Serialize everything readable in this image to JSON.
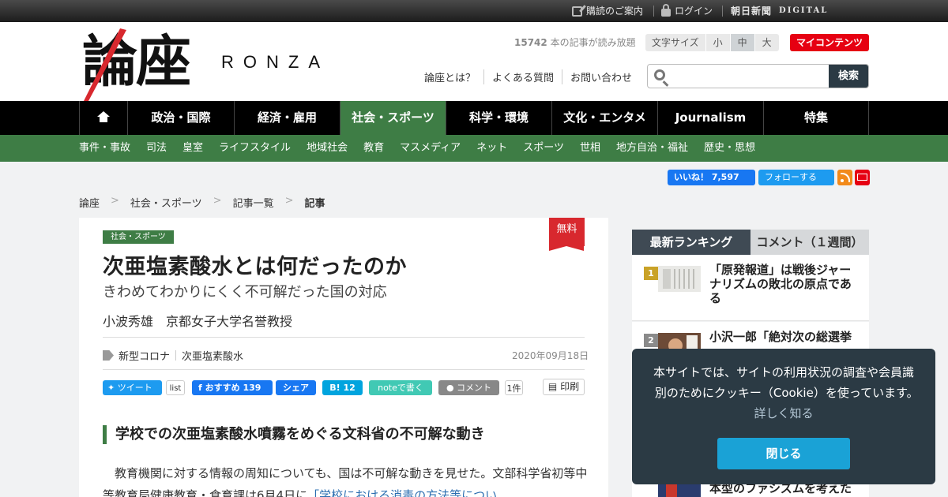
{
  "topbar": {
    "subscribe": "購読のご案内",
    "login": "ログイン",
    "asahi_logo": "朝日新聞",
    "asahi_digital": "DIGITAL"
  },
  "header": {
    "logo_kanji": "論座",
    "logo_roman": "RONZA",
    "reading_count": "15742",
    "reading_text": "本の記事が読み放題",
    "fontsize_label": "文字サイズ",
    "fontsize_options": [
      "小",
      "中",
      "大"
    ],
    "fontsize_selected": "中",
    "my_contents": "マイコンテンツ",
    "links": [
      "論座とは？",
      "よくある質問",
      "お問い合わせ"
    ],
    "search_placeholder": "",
    "search_button": "検索"
  },
  "nav": {
    "home_icon": "home-icon",
    "tabs": [
      "政治・国際",
      "経済・雇用",
      "社会・スポーツ",
      "科学・環境",
      "文化・エンタメ",
      "Journalism",
      "特集"
    ],
    "active": "社会・スポーツ",
    "subitems": [
      "事件・事故",
      "司法",
      "皇室",
      "ライフスタイル",
      "地域社会",
      "教育",
      "マスメディア",
      "ネット",
      "スポーツ",
      "世相",
      "地方自治・福祉",
      "歴史・思想"
    ]
  },
  "social": {
    "fb_like": "いいね！ 7,597",
    "tw_follow": "フォローする"
  },
  "breadcrumb": [
    "論座",
    "社会・スポーツ",
    "記事一覧",
    "記事"
  ],
  "article": {
    "category": "社会・スポーツ",
    "free_badge": "無料",
    "title": "次亜塩素酸水とは何だったのか",
    "subtitle": "きわめてわかりにくく不可解だった国の対応",
    "author": "小波秀雄　京都女子大学名誉教授",
    "tags": [
      "新型コロナ",
      "次亜塩素酸水"
    ],
    "date": "2020年09月18日",
    "share": {
      "tweet": "ツイート",
      "list": "list",
      "fb_recommend": "おすすめ 139",
      "fb_share": "シェア",
      "hatena": "B! 12",
      "note": "noteで書く",
      "comment": "コメント",
      "comment_count": "1件",
      "print": "印刷"
    },
    "heading": "学校での次亜塩素酸水噴霧をめぐる文科省の不可解な動き",
    "body_start": "教育機関に対する情報の周知についても、国は不可解な動きを見せた。文部科学省初等中等教育局健康教育・食育課は6月4日に",
    "body_link": "「学校における消毒の方法等につい"
  },
  "sidebar": {
    "tab_ranking": "最新ランキング",
    "tab_comment": "コメント（１週間）",
    "items": [
      {
        "rank": "1",
        "title": "「原発報道」は戦後ジャーナリズムの敗北の原点である"
      },
      {
        "rank": "2",
        "title": "小沢一郎「絶対次の総選挙"
      },
      {
        "rank": "",
        "title": "本型のファシズムを考えた"
      }
    ]
  },
  "cookie": {
    "message": "本サイトでは、サイトの利用状況の調査や会員識別のためにクッキー（Cookie）を使っています。",
    "more": "詳しく知る",
    "close": "閉じる"
  },
  "colors": {
    "accent_green": "#3e7d45",
    "brand_red": "#e60012",
    "nav_black": "#000000",
    "cookie_bg": "#2b3a44",
    "cookie_button": "#1aa2d6"
  }
}
